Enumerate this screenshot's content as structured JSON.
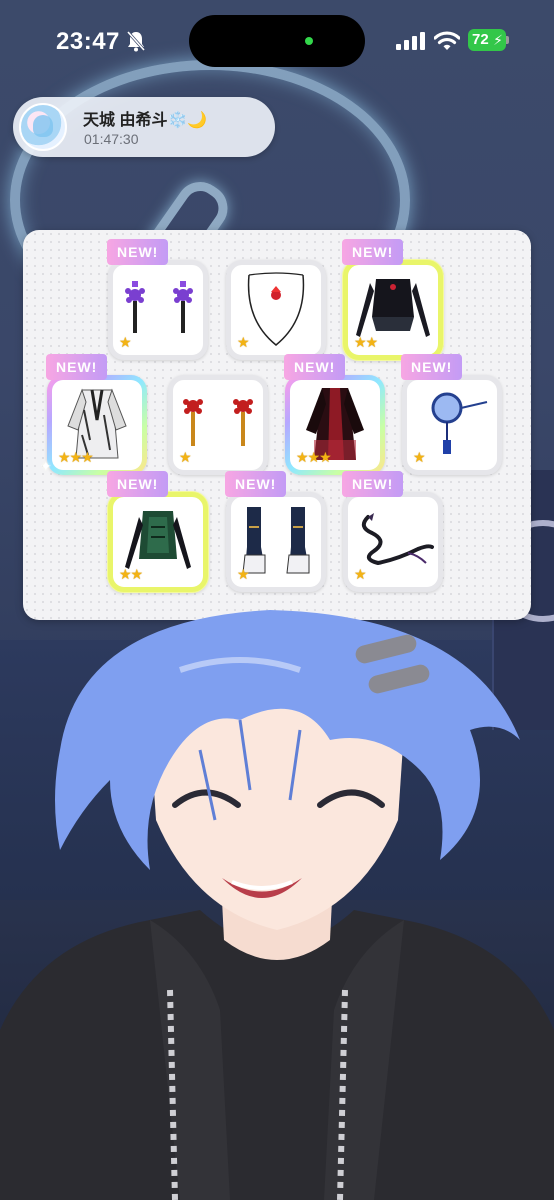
{
  "status_bar": {
    "time": "23:47",
    "battery": "72"
  },
  "profile": {
    "name": "天城 由希斗❄️🌙",
    "elapsed": "01:47:30"
  },
  "rewards": {
    "badge_label": "NEW!",
    "items": [
      {
        "name": "purple-flower-tassel-earrings",
        "stars": "★",
        "is_new": true
      },
      {
        "name": "red-emblem-choker",
        "stars": "★",
        "is_new": false
      },
      {
        "name": "black-sleeveless-top-with-gloves",
        "stars": "★★",
        "is_new": true
      },
      {
        "name": "white-black-kimono-robe",
        "stars": "★★★",
        "is_new": true
      },
      {
        "name": "red-flower-tassel-earrings",
        "stars": "★",
        "is_new": false
      },
      {
        "name": "black-red-robe-outfit",
        "stars": "★★★",
        "is_new": true
      },
      {
        "name": "blue-round-glasses",
        "stars": "★",
        "is_new": true
      },
      {
        "name": "green-vest-with-gloves",
        "stars": "★★",
        "is_new": true
      },
      {
        "name": "white-black-boots",
        "stars": "★",
        "is_new": true
      },
      {
        "name": "black-dragon-accessory",
        "stars": "★",
        "is_new": true
      }
    ]
  },
  "colors": {
    "new_badge": "#f7a6e3",
    "star": "#f3b315",
    "battery": "#33c749",
    "hair": "#7f9ff0"
  }
}
